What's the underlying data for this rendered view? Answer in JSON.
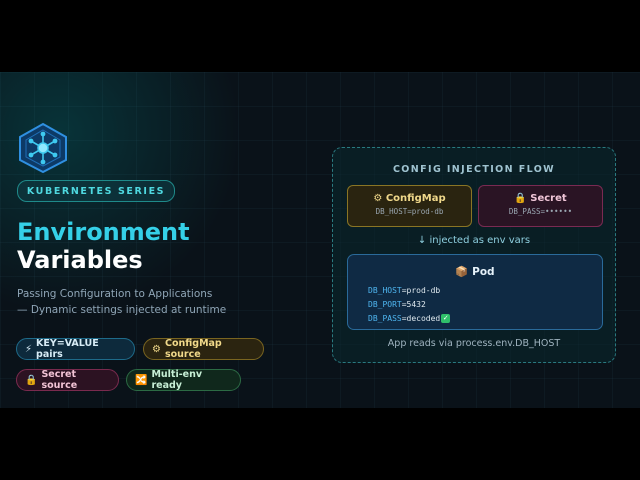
{
  "header": {
    "series_label": "KUBERNETES SERIES",
    "title_accent": "Environment",
    "title_rest": "Variables",
    "subtitle_line1": "Passing Configuration to Applications",
    "subtitle_line2": "— Dynamic settings injected at runtime",
    "logo_icon": "kubernetes-helm-icon"
  },
  "chips": [
    {
      "icon": "⚡",
      "label": "KEY=VALUE pairs"
    },
    {
      "icon": "⚙",
      "label": "ConfigMap source"
    },
    {
      "icon": "🔒",
      "label": "Secret source"
    },
    {
      "icon": "🔀",
      "label": "Multi-env ready"
    }
  ],
  "flow": {
    "title": "CONFIG INJECTION FLOW",
    "configmap": {
      "icon": "⚙",
      "title": "ConfigMap",
      "value": "DB_HOST=prod-db"
    },
    "secret": {
      "icon": "🔒",
      "title": "Secret",
      "value": "DB_PASS=••••••"
    },
    "injected": "↓ injected as env vars",
    "pod": {
      "icon": "📦",
      "title": "Pod",
      "env": [
        {
          "key": "DB_HOST",
          "value": "=prod-db"
        },
        {
          "key": "DB_PORT",
          "value": "=5432"
        },
        {
          "key": "DB_PASS",
          "value": "=decoded",
          "check": "✓"
        }
      ]
    },
    "reads": "App reads via process.env.DB_HOST"
  },
  "colors": {
    "accent": "#35d0e8",
    "configmap": "#f0d88a",
    "secret": "#f1c6d8",
    "pod_border": "#2a6a9a",
    "env_key": "#4fb6f0"
  }
}
